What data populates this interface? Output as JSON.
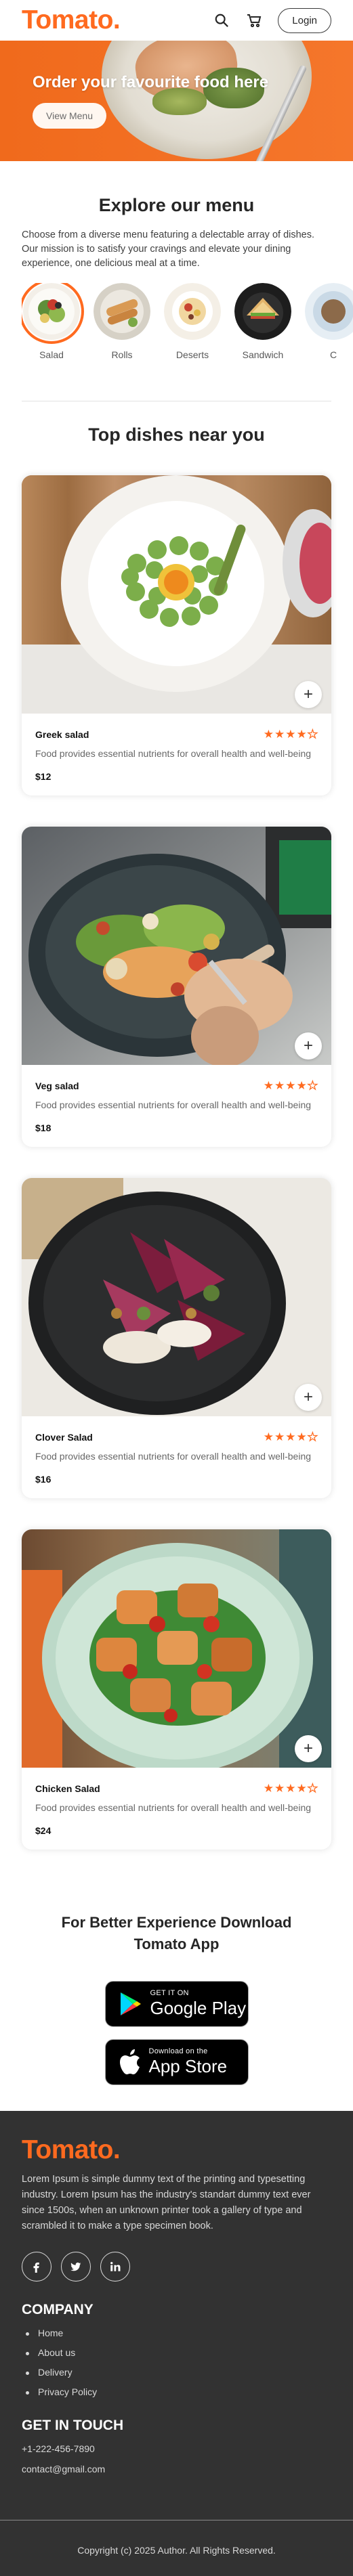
{
  "navbar": {
    "logo": "Tomato.",
    "login_label": "Login",
    "icons": [
      "search-icon",
      "basket-icon"
    ]
  },
  "hero": {
    "title": "Order your favourite food here",
    "button_label": "View Menu"
  },
  "explore": {
    "title": "Explore our menu",
    "text": "Choose from a diverse menu featuring a delectable array of dishes. Our mission is to satisfy your cravings and elevate your dining experience, one delicious meal at a time.",
    "items": [
      {
        "label": "Salad"
      },
      {
        "label": "Rolls"
      },
      {
        "label": "Deserts"
      },
      {
        "label": "Sandwich"
      },
      {
        "label": "C"
      }
    ]
  },
  "dishes": {
    "title": "Top dishes near you",
    "items": [
      {
        "name": "Greek salad",
        "desc": "Food provides essential nutrients for overall health and well-being",
        "price": "$12",
        "rating": 4
      },
      {
        "name": "Veg salad",
        "desc": "Food provides essential nutrients for overall health and well-being",
        "price": "$18",
        "rating": 4
      },
      {
        "name": "Clover Salad",
        "desc": "Food provides essential nutrients for overall health and well-being",
        "price": "$16",
        "rating": 4
      },
      {
        "name": "Chicken Salad",
        "desc": "Food provides essential nutrients for overall health and well-being",
        "price": "$24",
        "rating": 4
      }
    ]
  },
  "app_download": {
    "title_line1": "For Better Experience Download",
    "title_line2": "Tomato App",
    "google_small": "GET IT ON",
    "google_big": "Google Play",
    "apple_small": "Download on the",
    "apple_big": "App Store"
  },
  "footer": {
    "logo": "Tomato.",
    "text": "Lorem Ipsum is simple dummy text of the printing and typesetting industry. Lorem Ipsum has the industry's standart dummy text ever since 1500s, when an unknown printer took a gallery of type and scrambled it to make a type specimen book.",
    "social_icons": [
      "facebook-icon",
      "twitter-icon",
      "linkedin-icon"
    ],
    "company_heading": "COMPANY",
    "company_links": [
      "Home",
      "About us",
      "Delivery",
      "Privacy Policy"
    ],
    "contact_heading": "GET IN TOUCH",
    "phone": "+1-222-456-7890",
    "email": "contact@gmail.com",
    "copyright": "Copyright (c) 2025 Author. All Rights Reserved."
  },
  "colors": {
    "accent": "#ff6a1f",
    "footer_bg": "#323232"
  }
}
